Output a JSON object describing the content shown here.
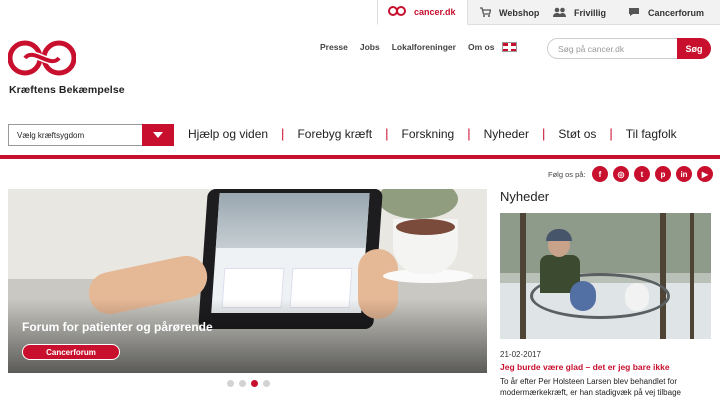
{
  "topbar": {
    "tabs": [
      {
        "label": "cancer.dk",
        "icon": "cancer-dk-logo-icon",
        "active": true
      },
      {
        "label": "Webshop",
        "icon": "cart-icon",
        "active": false
      },
      {
        "label": "Frivillig",
        "icon": "people-icon",
        "active": false
      },
      {
        "label": "Cancerforum",
        "icon": "chat-bubble-icon",
        "active": false
      }
    ]
  },
  "brand": {
    "name": "Kræftens Bekæmpelse",
    "color": "#c8102e"
  },
  "header_links": [
    "Presse",
    "Jobs",
    "Lokalforeninger",
    "Om os"
  ],
  "search": {
    "placeholder": "Søg på cancer.dk",
    "button": "Søg"
  },
  "cancer_select": {
    "value": "Vælg kræftsygdom"
  },
  "nav": [
    "Hjælp og viden",
    "Forebyg kræft",
    "Forskning",
    "Nyheder",
    "Støt os",
    "Til fagfolk"
  ],
  "follow": {
    "label": "Følg os på:",
    "icons": [
      "facebook-icon",
      "instagram-icon",
      "twitter-icon",
      "pinterest-icon",
      "linkedin-icon",
      "youtube-icon"
    ],
    "glyphs": [
      "f",
      "◎",
      "t",
      "p",
      "in",
      "▶"
    ]
  },
  "hero": {
    "title": "Forum for patienter og pårørende",
    "button": "Cancerforum",
    "slides": 4,
    "active_slide": 3
  },
  "news": {
    "heading": "Nyheder",
    "date": "21-02-2017",
    "title": "Jeg burde være glad – det er jeg bare ikke",
    "text": "To år efter Per Holsteen Larsen blev behandlet for modermærkekræft, er han stadigvæk på vej tilbage"
  }
}
